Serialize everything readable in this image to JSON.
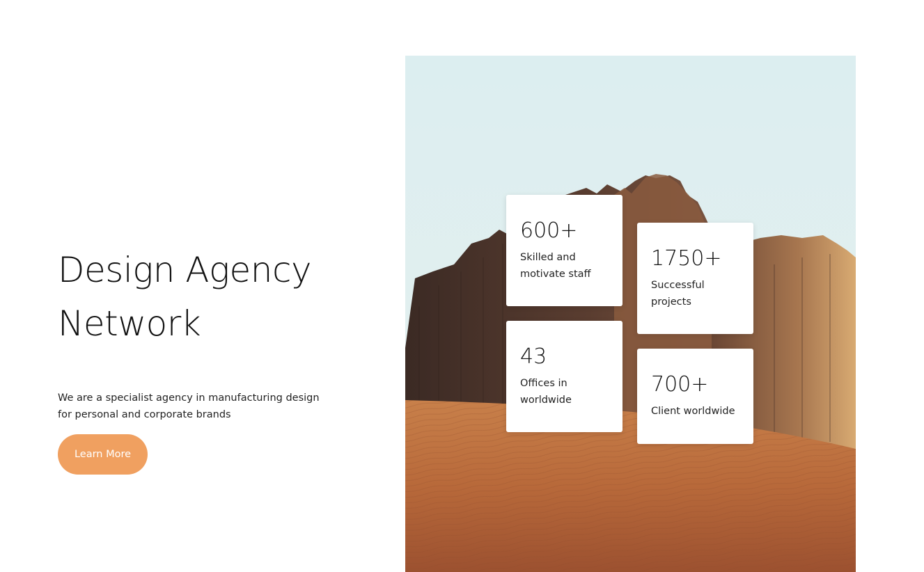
{
  "hero": {
    "title_line_1": "Design Agency",
    "title_line_2": "Network",
    "description": "We are a specialist agency in manufacturing design for personal and corporate brands",
    "button_label": "Learn More"
  },
  "stats": [
    {
      "value": "600+",
      "label_line_1": "Skilled and",
      "label_line_2": "motivate staff"
    },
    {
      "value": "1750+",
      "label_line_1": "Successful",
      "label_line_2": "projects"
    },
    {
      "value": "43",
      "label_line_1": "Offices in",
      "label_line_2": "worldwide"
    },
    {
      "value": "700+",
      "label_line_1": "Client worldwide",
      "label_line_2": ""
    }
  ],
  "colors": {
    "accent": "#f0a060",
    "sky": "#dcecef",
    "sand": "#c47a45",
    "rock": "#5a3a2c"
  },
  "image": {
    "subject": "desert-rock-landscape"
  }
}
